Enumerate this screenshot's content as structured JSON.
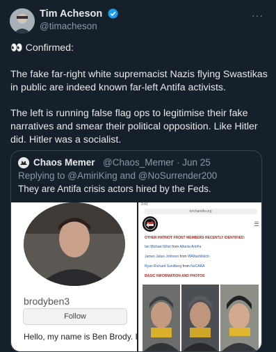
{
  "tweet": {
    "author_name": "Tim Acheson",
    "handle": "@timacheson",
    "more_label": "···",
    "paragraphs": [
      [
        "👀 Confirmed:"
      ],
      [
        "The fake far-right white supremacist Nazis flying Swastikas",
        "in public are indeed known far-left Antifa activists."
      ],
      [
        "The left is running false flag ops to legitimise their fake",
        "narratives and smear their political opposition. Like Hitler",
        "did. Hitler was a socialist."
      ]
    ]
  },
  "quote": {
    "author_name": "Chaos Memer",
    "meta": "@Chaos_Memer · Jun 25",
    "replying_to": "Replying to @AmiriKing and @NoSurrender200",
    "text": "They are Antifa crisis actors hired by the Feds.",
    "left_image": {
      "username": "brodyben3",
      "follow_label": "Follow",
      "bio": "Hello, my name is Ben Brody. I am"
    },
    "right_image": {
      "status_time": "9:41",
      "url": "torchantifa.org",
      "heading1": "OTHER PATRIOT FRONT MEMBERS RECENTLY IDENTIFIED:",
      "entries": [
        {
          "name": "Ian Michael Elliot",
          "from": "from",
          "source": "Atlanta AntiFa"
        },
        {
          "name": "James Julius Johnson",
          "from": "from",
          "source": "WANazWatch"
        },
        {
          "name": "Ryan Richard Sundberg",
          "from": "from",
          "source": "NoCARA"
        }
      ],
      "heading2": "BASIC INFORMATION AND PHOTOS"
    }
  },
  "colors": {
    "background": "#15202b",
    "text": "#e7e9ea",
    "muted": "#8b98a5",
    "border": "#38444d",
    "verified": "#1d9bf0"
  }
}
